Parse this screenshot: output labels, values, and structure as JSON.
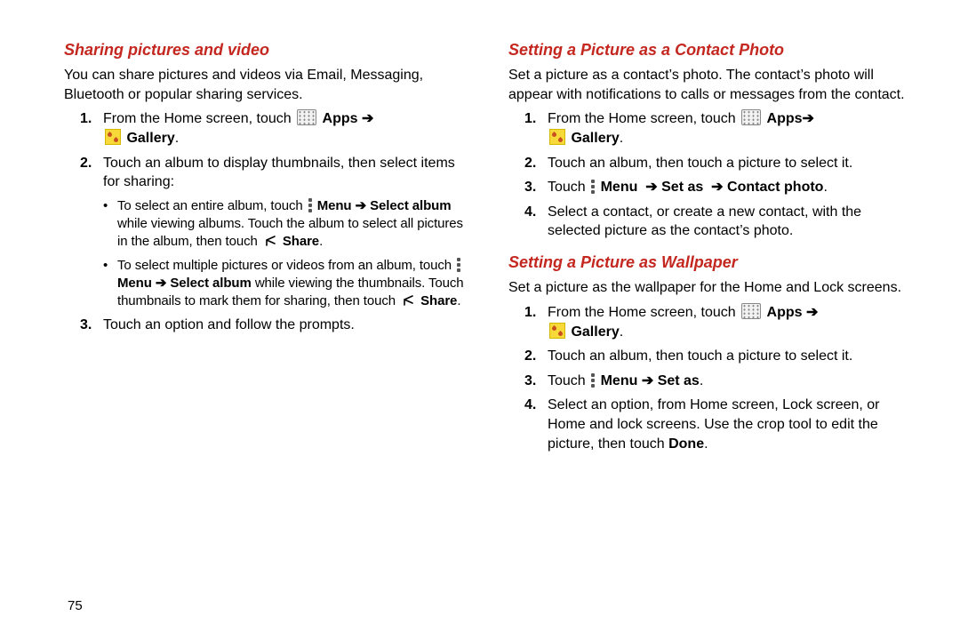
{
  "page_number": "75",
  "left": {
    "heading": "Sharing pictures and video",
    "intro": "You can share pictures and videos via Email, Messaging, Bluetooth or popular sharing services.",
    "step1_prefix": "From the Home screen, touch ",
    "apps_label": "Apps",
    "arrow": "➔",
    "gallery_label": "Gallery",
    "period": ".",
    "step2": "Touch an album to display thumbnails, then select items for sharing:",
    "sub1_a": "To select an entire album, touch ",
    "menu_label": "Menu",
    "select_album_label": "Select album",
    "sub1_b": " while viewing albums. Touch the album to select all pictures in the album, then touch ",
    "share_label": "Share",
    "sub2_a": "To select multiple pictures or videos from an album, touch ",
    "sub2_b": " while viewing the thumbnails. Touch thumbnails to mark them for sharing, then touch ",
    "step3": "Touch an option and follow the prompts."
  },
  "right_a": {
    "heading": "Setting a Picture as a Contact Photo",
    "intro": "Set a picture as a contact’s photo. The contact’s photo will appear with notifications to calls or messages from the contact.",
    "step1_prefix": "From the Home screen, touch ",
    "apps_label": "Apps",
    "arrow": "➔",
    "gallery_label": "Gallery",
    "period": ".",
    "step2": "Touch an album, then touch a picture to select it.",
    "step3_prefix": "Touch ",
    "menu_label": "Menu",
    "setas_label": "Set as",
    "contactphoto_label": "Contact photo",
    "step4": "Select a contact, or create a new contact, with the selected picture as the contact’s photo."
  },
  "right_b": {
    "heading": "Setting a Picture as Wallpaper",
    "intro": "Set a picture as the wallpaper for the Home and Lock screens.",
    "step1_prefix": "From the Home screen, touch ",
    "apps_label": "Apps",
    "arrow": "➔",
    "gallery_label": "Gallery",
    "period": ".",
    "step2": "Touch an album, then touch a picture to select it.",
    "step3_prefix": "Touch ",
    "menu_label": "Menu",
    "setas_label": "Set as",
    "step4_a": "Select an option, from Home screen, Lock screen, or Home and lock screens. Use the crop tool to edit the picture, then touch ",
    "done_label": "Done",
    "step4_b": "."
  }
}
